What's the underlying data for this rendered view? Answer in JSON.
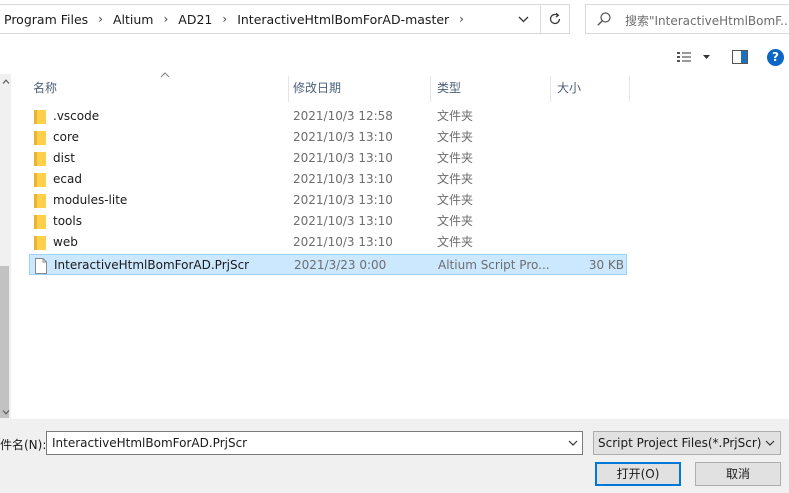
{
  "address": {
    "breadcrumbs": [
      "Program Files",
      "Altium",
      "AD21",
      "InteractiveHtmlBomForAD-master"
    ],
    "separator": "›"
  },
  "search": {
    "placeholder": "搜索\"InteractiveHtmlBomF..."
  },
  "columns": {
    "name": "名称",
    "date": "修改日期",
    "type": "类型",
    "size": "大小"
  },
  "files": [
    {
      "name": ".vscode",
      "date": "2021/10/3 12:58",
      "type": "文件夹",
      "size": "",
      "kind": "folder",
      "selected": false
    },
    {
      "name": "core",
      "date": "2021/10/3 13:10",
      "type": "文件夹",
      "size": "",
      "kind": "folder",
      "selected": false
    },
    {
      "name": "dist",
      "date": "2021/10/3 13:10",
      "type": "文件夹",
      "size": "",
      "kind": "folder",
      "selected": false
    },
    {
      "name": "ecad",
      "date": "2021/10/3 13:10",
      "type": "文件夹",
      "size": "",
      "kind": "folder",
      "selected": false
    },
    {
      "name": "modules-lite",
      "date": "2021/10/3 13:10",
      "type": "文件夹",
      "size": "",
      "kind": "folder",
      "selected": false
    },
    {
      "name": "tools",
      "date": "2021/10/3 13:10",
      "type": "文件夹",
      "size": "",
      "kind": "folder",
      "selected": false
    },
    {
      "name": "web",
      "date": "2021/10/3 13:10",
      "type": "文件夹",
      "size": "",
      "kind": "folder",
      "selected": false
    },
    {
      "name": "InteractiveHtmlBomForAD.PrjScr",
      "date": "2021/3/23 0:00",
      "type": "Altium Script Pro...",
      "size": "30 KB",
      "kind": "file",
      "selected": true
    }
  ],
  "bottom": {
    "filename_label": "件名(N):",
    "filename_value": "InteractiveHtmlBomForAD.PrjScr",
    "filetype_value": "Script Project Files(*.PrjScr)",
    "open_label": "打开(O)",
    "cancel_label": "取消"
  },
  "help_label": "?",
  "colors": {
    "folder": "#ffd04d",
    "folder_dark": "#e8b431",
    "selection_bg": "#cce8ff",
    "selection_border": "#99d1ff",
    "accent": "#0078d7",
    "help": "#0a67c4",
    "header_text": "#4c607a"
  },
  "icons": {
    "addr_dropdown": "chevron-down-icon",
    "refresh": "refresh-icon",
    "search": "search-icon",
    "view": "view-options-icon",
    "preview": "preview-pane-icon",
    "help": "help-icon",
    "folder": "folder-icon",
    "file": "file-icon"
  }
}
